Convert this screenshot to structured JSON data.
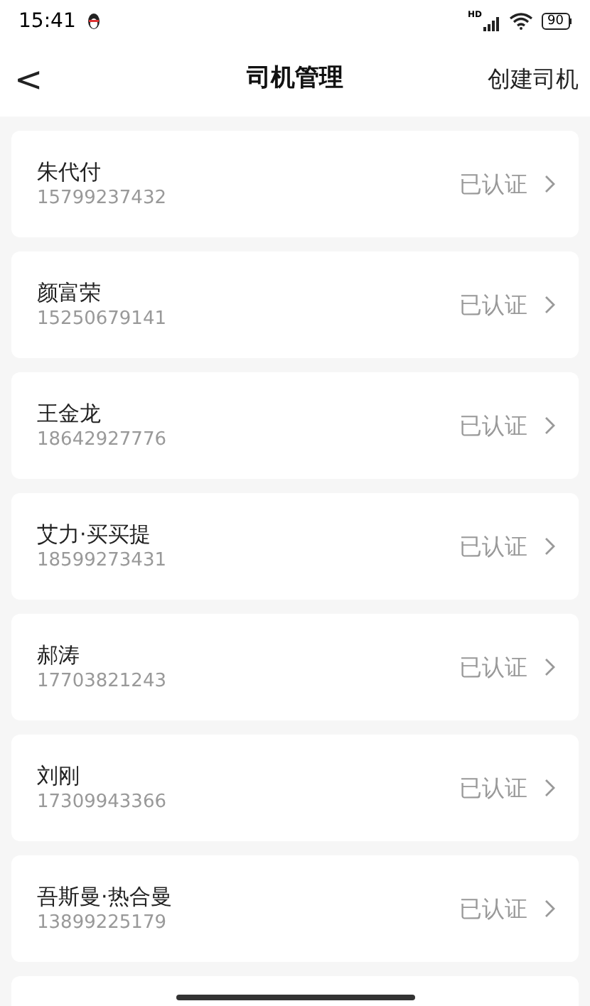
{
  "status_bar": {
    "time": "15:41",
    "network": "HD",
    "battery": "90"
  },
  "header": {
    "back": "<",
    "title": "司机管理",
    "action": "创建司机"
  },
  "drivers": [
    {
      "name": "朱代付",
      "phone": "15799237432",
      "status": "已认证"
    },
    {
      "name": "颜富荣",
      "phone": "15250679141",
      "status": "已认证"
    },
    {
      "name": "王金龙",
      "phone": "18642927776",
      "status": "已认证"
    },
    {
      "name": "艾力·买买提",
      "phone": "18599273431",
      "status": "已认证"
    },
    {
      "name": "郝涛",
      "phone": "17703821243",
      "status": "已认证"
    },
    {
      "name": "刘刚",
      "phone": "17309943366",
      "status": "已认证"
    },
    {
      "name": "吾斯曼·热合曼",
      "phone": "13899225179",
      "status": "已认证"
    }
  ]
}
